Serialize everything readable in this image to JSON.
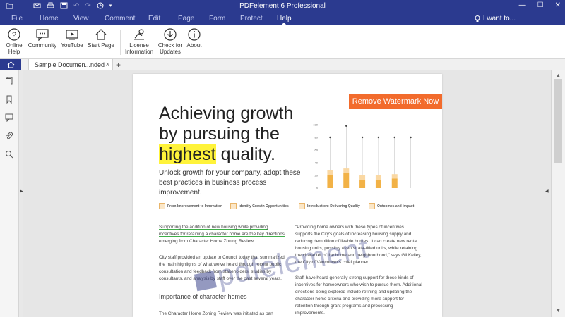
{
  "app": {
    "title": "PDFelement 6 Professional",
    "quick_access": [
      "folder-icon",
      "save-icon",
      "print-icon",
      "email-icon",
      "undo-icon",
      "redo-icon",
      "history-icon",
      "customize-icon"
    ]
  },
  "menu": {
    "tabs": [
      "File",
      "Home",
      "View",
      "Comment",
      "Edit",
      "Page",
      "Form",
      "Protect",
      "Help"
    ],
    "active": "Help",
    "search_label": "I want to..."
  },
  "ribbon": {
    "buttons": [
      {
        "label": "Online Help",
        "icon": "question-icon"
      },
      {
        "label": "Community",
        "icon": "chat-icon"
      },
      {
        "label": "YouTube",
        "icon": "youtube-icon"
      },
      {
        "label": "Start Page",
        "icon": "home-icon"
      },
      {
        "label": "License Information",
        "icon": "license-icon"
      },
      {
        "label": "Check for Updates",
        "icon": "download-icon"
      },
      {
        "label": "About",
        "icon": "info-icon"
      }
    ]
  },
  "tabs": {
    "doc_tab": "Sample Documen...nded",
    "close": "×",
    "add": "+"
  },
  "sidebar": {
    "items": [
      "pages-icon",
      "bookmark-icon",
      "comment-icon",
      "attachment-icon",
      "search-icon"
    ]
  },
  "page": {
    "watermark_button": "Remove Watermark Now",
    "headline_1": "Achieving growth",
    "headline_2": "by pursuing the",
    "headline_hl": "highest",
    "headline_3": " quality.",
    "subhead": "Unlock growth for your company, adopt these best practices in business process improvement.",
    "icon_row": [
      "From Improvement to Innovation",
      "Identify Growth Opportunities",
      "Introduction: Delivering Quality",
      "Outcomes and Impact"
    ],
    "left_col_p1_ul": "Supporting the addition of new housing while providing incentives for retaining a character home are the key directions",
    "left_col_p1_rest": " emerging from Character Home Zoning Review.",
    "left_col_p2": "City staff provided an update to Council today that summarized the main highlights of what we've heard through recent public consultation and feedback from stakeholders, studies by consultants, and analysis by staff over the past several years.",
    "section_heading": "Importance of character homes",
    "left_col_p3": "The Character Home Zoning Review was initiated as part",
    "right_col_p1": "\"Providing home owners with these types of incentives supports the City's goals of increasing housing supply and reducing demolition of livable homes.  It can create new rental housing units, possibly even strata-titled units, while retaining the character of the home and neighbourhood,\" says Gil Kelley, the City of Vancouver's chief planner.",
    "right_col_p2": "Staff have heard generally strong support for these kinds of incentives for homeowners who wish to pursue them. Additional directions being explored include refining and updating the character home criteria and providing more support for retention through grant programs and processing improvements.",
    "pdf_watermark": "pdfelement"
  },
  "chart_data": {
    "type": "bar",
    "categories": [
      "",
      "",
      "",
      "",
      "",
      ""
    ],
    "ylim": [
      0,
      100
    ],
    "y_ticks": [
      "100",
      "80",
      "60",
      "40",
      "20",
      "0"
    ],
    "series": [
      {
        "values": [
          20,
          24,
          13,
          13,
          15,
          0
        ]
      },
      {
        "values": [
          28,
          31,
          21,
          21,
          22,
          0
        ]
      }
    ],
    "markers": [
      80,
      98,
      80,
      80,
      80,
      80
    ],
    "colors": {
      "lower": "#f2b246",
      "upper": "#fad8a3",
      "marker": "#444444"
    }
  }
}
